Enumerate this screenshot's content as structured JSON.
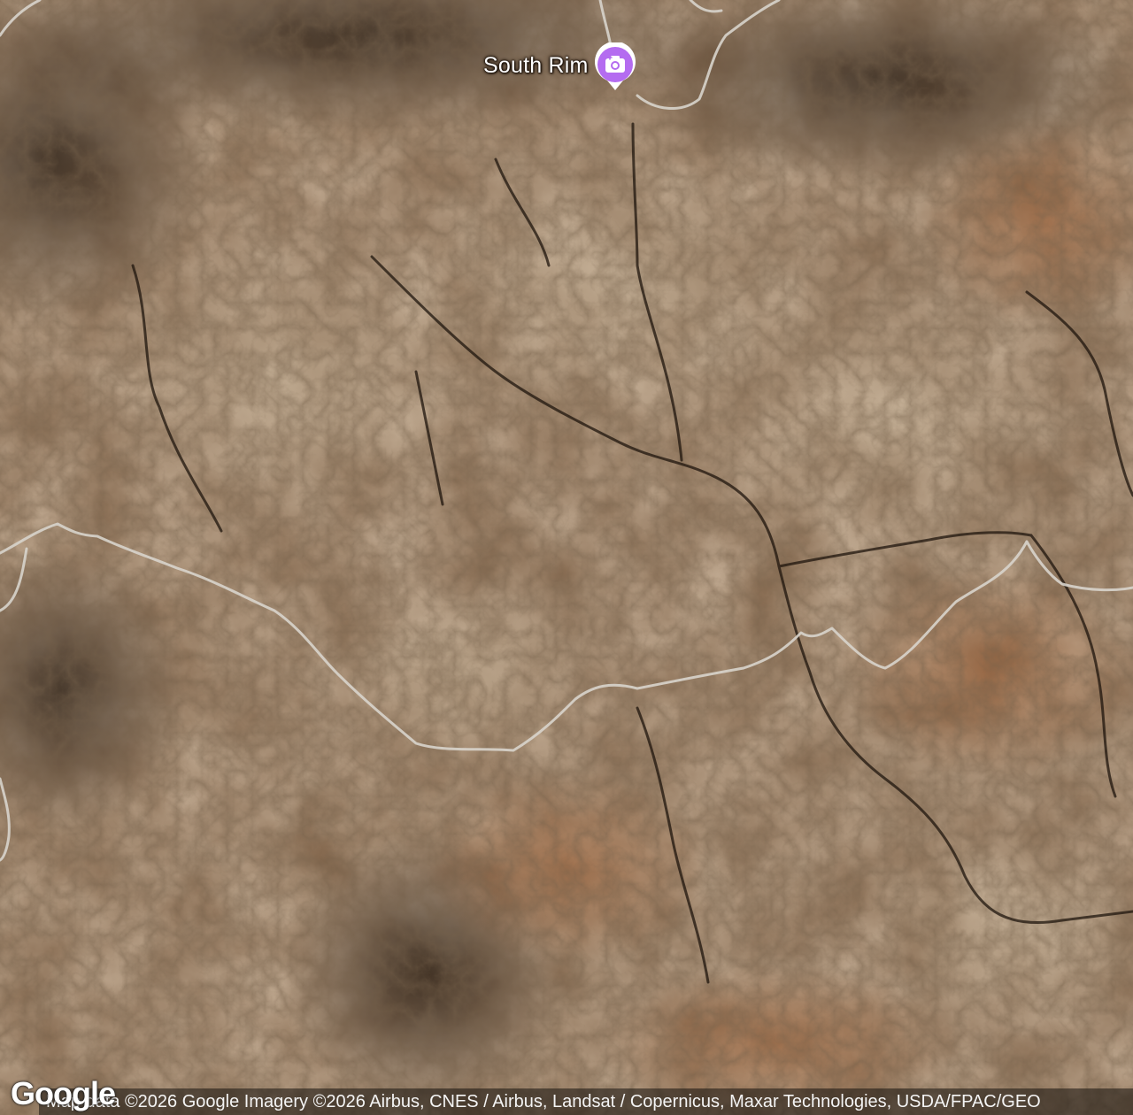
{
  "map": {
    "type": "satellite",
    "poi": {
      "label": "South Rim",
      "icon": "camera-icon",
      "color": "#b46cf0"
    },
    "branding": {
      "logo_text": "Google"
    },
    "attribution": {
      "text": "Map data ©2026 Google Imagery ©2026 Airbus, CNES / Airbus, Landsat / Copernicus, Maxar Technologies, USDA/FPAC/GEO"
    },
    "colors": {
      "terrain_light": "#b8a389",
      "terrain_mid": "#8a6a4c",
      "terrain_dark": "#3a2a1c",
      "road": "#d8d4cc"
    }
  }
}
